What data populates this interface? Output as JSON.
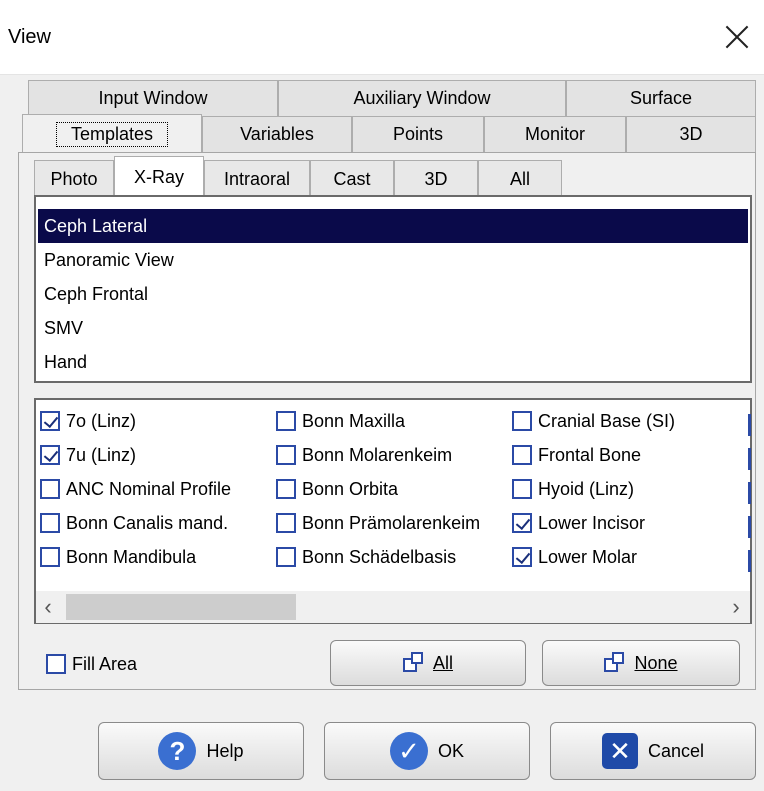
{
  "window": {
    "title": "View"
  },
  "tabs_row1": [
    {
      "label": "Input Window"
    },
    {
      "label": "Auxiliary Window"
    },
    {
      "label": "Surface"
    }
  ],
  "tabs_row2": [
    {
      "label": "Templates",
      "active": true
    },
    {
      "label": "Variables"
    },
    {
      "label": "Points"
    },
    {
      "label": "Monitor"
    },
    {
      "label": "3D"
    }
  ],
  "subtabs": [
    {
      "label": "Photo"
    },
    {
      "label": "X-Ray",
      "active": true
    },
    {
      "label": "Intraoral"
    },
    {
      "label": "Cast"
    },
    {
      "label": "3D"
    },
    {
      "label": "All"
    }
  ],
  "template_list": [
    {
      "label": "Ceph Lateral",
      "selected": true
    },
    {
      "label": "Panoramic View"
    },
    {
      "label": "Ceph Frontal"
    },
    {
      "label": "SMV"
    },
    {
      "label": "Hand"
    }
  ],
  "checkboxes": {
    "col1": [
      {
        "label": "7o (Linz)",
        "checked": true
      },
      {
        "label": "7u (Linz)",
        "checked": true
      },
      {
        "label": "ANC Nominal Profile",
        "checked": false
      },
      {
        "label": "Bonn Canalis mand.",
        "checked": false
      },
      {
        "label": "Bonn Mandibula",
        "checked": false
      }
    ],
    "col2": [
      {
        "label": "Bonn Maxilla",
        "checked": false
      },
      {
        "label": "Bonn Molarenkeim",
        "checked": false
      },
      {
        "label": "Bonn Orbita",
        "checked": false
      },
      {
        "label": "Bonn Prämolarenkeim",
        "checked": false
      },
      {
        "label": "Bonn Schädelbasis",
        "checked": false
      }
    ],
    "col3": [
      {
        "label": "Cranial Base (SI)",
        "checked": false
      },
      {
        "label": "Frontal Bone",
        "checked": false
      },
      {
        "label": "Hyoid (Linz)",
        "checked": false
      },
      {
        "label": "Lower Incisor",
        "checked": true
      },
      {
        "label": "Lower Molar",
        "checked": true
      }
    ]
  },
  "fill_area": {
    "label": "Fill Area",
    "checked": false
  },
  "buttons": {
    "all": "All",
    "none": "None",
    "help": "Help",
    "ok": "OK",
    "cancel": "Cancel"
  },
  "colors": {
    "selection": "#0a0a4a",
    "checkbox_border": "#2b4aa6",
    "help_icon": "#3a6fd1",
    "ok_icon": "#3a6fd1",
    "cancel_icon": "#1f4aa8"
  }
}
